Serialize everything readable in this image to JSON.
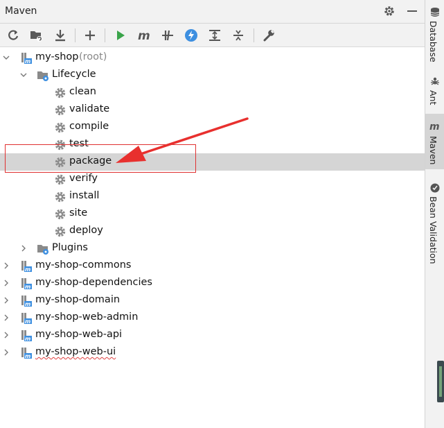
{
  "panel": {
    "title": "Maven",
    "settings_icon": "gear-icon",
    "minimize_icon": "minimize-icon"
  },
  "toolbar": {
    "buttons": [
      {
        "name": "reload-all-projects",
        "icon": "refresh-icon"
      },
      {
        "name": "generate-sources-and-update-folders",
        "icon": "folder-sync-icon"
      },
      {
        "name": "download-sources",
        "icon": "download-icon"
      },
      {
        "name": "add-maven-projects",
        "icon": "plus-icon"
      },
      {
        "name": "run-maven-build",
        "icon": "play-icon"
      },
      {
        "name": "execute-maven-goal",
        "icon": "maven-m-icon"
      },
      {
        "name": "toggle-offline-mode",
        "icon": "offline-icon"
      },
      {
        "name": "toggle-skip-tests-mode",
        "icon": "lightning-icon"
      },
      {
        "name": "show-dependencies",
        "icon": "expand-icon"
      },
      {
        "name": "collapse-all",
        "icon": "collapse-icon"
      },
      {
        "name": "maven-settings",
        "icon": "wrench-icon"
      }
    ]
  },
  "tree": {
    "root": {
      "name": "my-shop",
      "suffix": "(root)"
    },
    "lifecycle_label": "Lifecycle",
    "lifecycle_goals": [
      "clean",
      "validate",
      "compile",
      "test",
      "package",
      "verify",
      "install",
      "site",
      "deploy"
    ],
    "selected_goal": "package",
    "plugins_label": "Plugins",
    "modules": [
      "my-shop-commons",
      "my-shop-dependencies",
      "my-shop-domain",
      "my-shop-web-admin",
      "my-shop-web-api",
      "my-shop-web-ui"
    ]
  },
  "side_tabs": [
    {
      "label": "Database",
      "icon": "database-icon"
    },
    {
      "label": "Ant",
      "icon": "ant-icon"
    },
    {
      "label": "Maven",
      "icon": "maven-m-icon",
      "active": true
    },
    {
      "label": "Bean Validation",
      "icon": "bean-validation-icon"
    }
  ],
  "colors": {
    "selection": "#d5d5d5",
    "annotation": "#e03030",
    "run_green": "#3aa44a",
    "skip_tests_blue": "#3d8fe0"
  }
}
